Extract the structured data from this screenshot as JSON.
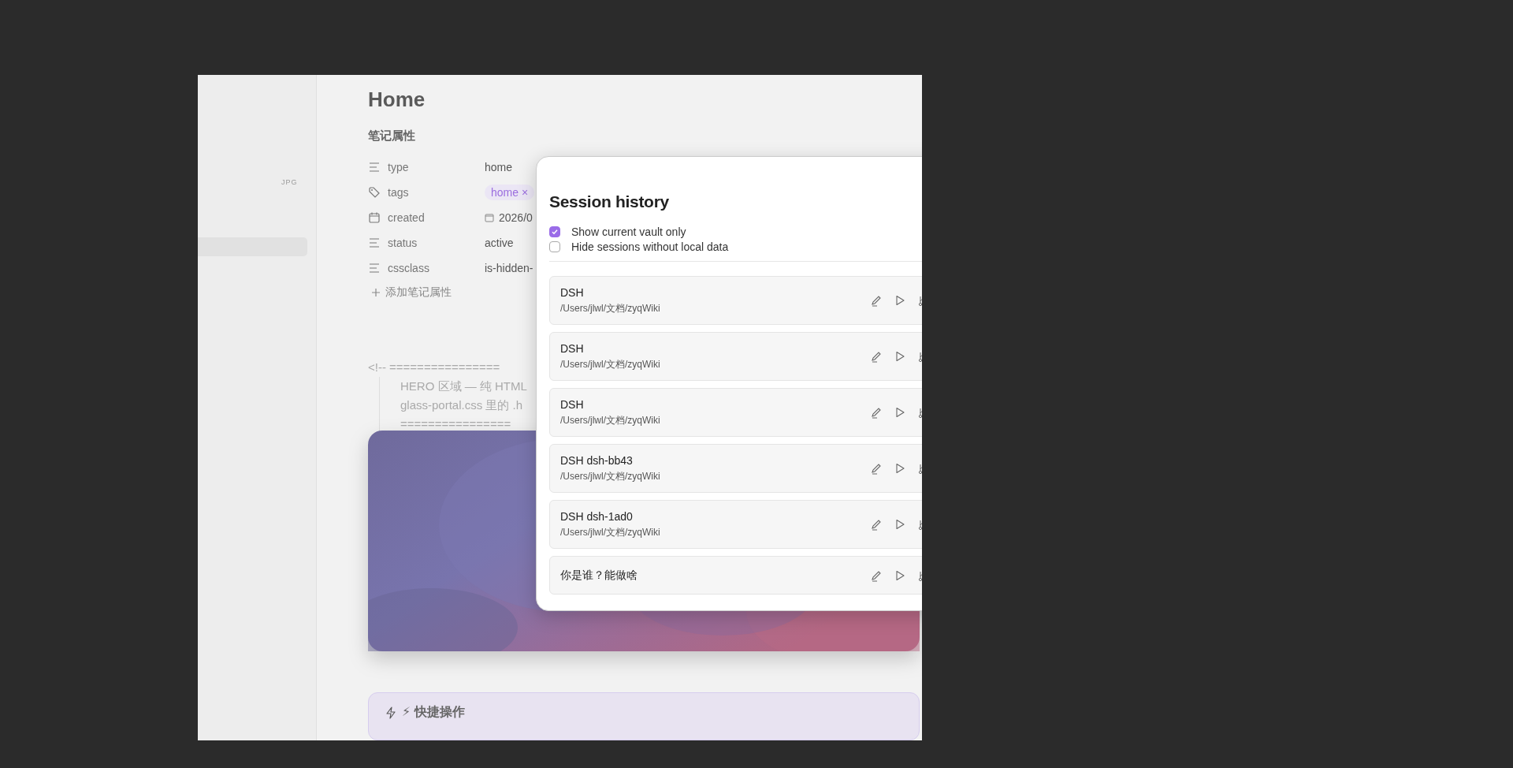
{
  "sidebar": {
    "file_badge": "JPG",
    "items": [
      {
        "selected": true
      }
    ]
  },
  "note": {
    "title": "Home",
    "properties_heading": "笔记属性",
    "properties": [
      {
        "kind": "text",
        "name": "type",
        "value": "home"
      },
      {
        "kind": "tags",
        "name": "tags",
        "value": "home",
        "remove": "×"
      },
      {
        "kind": "date",
        "name": "created",
        "value": "2026/0"
      },
      {
        "kind": "text",
        "name": "status",
        "value": "active"
      },
      {
        "kind": "text",
        "name": "cssclass",
        "value": "is-hidden-"
      }
    ],
    "add_property": "添加笔记属性",
    "comment": [
      "<!-- ================",
      "HERO 区域 — 纯 HTML",
      "glass-portal.css 里的 .h",
      "================"
    ],
    "hero": {
      "kind": "picture"
    },
    "quick_actions": {
      "title": "⚡ 快捷操作"
    }
  },
  "session_history": {
    "title": "Session history",
    "options": [
      {
        "label": "Show current vault only",
        "checked": true
      },
      {
        "label": "Hide sessions without local data",
        "checked": false
      }
    ],
    "sessions": [
      {
        "name": "DSH",
        "path": "/Users/jlwl/文档/zyqWiki"
      },
      {
        "name": "DSH",
        "path": "/Users/jlwl/文档/zyqWiki"
      },
      {
        "name": "DSH",
        "path": "/Users/jlwl/文档/zyqWiki"
      },
      {
        "name": "DSH dsh-bb43",
        "path": "/Users/jlwl/文档/zyqWiki"
      },
      {
        "name": "DSH dsh-1ad0",
        "path": "/Users/jlwl/文档/zyqWiki"
      },
      {
        "name": "你是谁？能做啥"
      }
    ]
  }
}
